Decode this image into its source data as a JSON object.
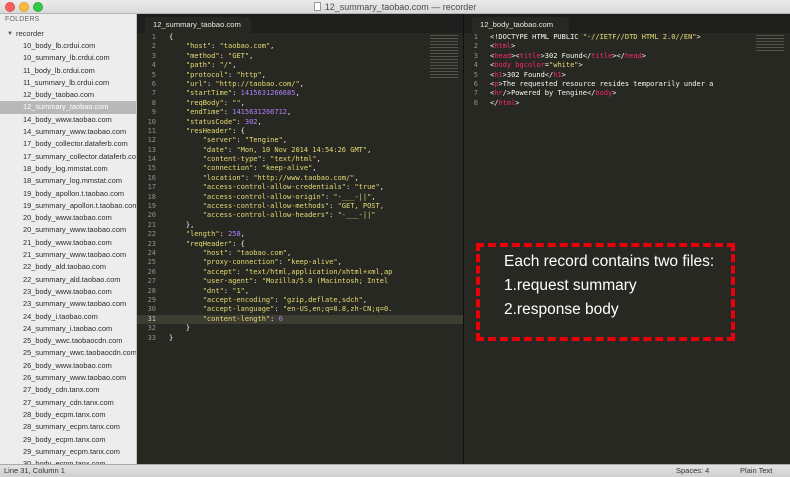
{
  "window": {
    "title": "12_summary_taobao.com — recorder"
  },
  "sidebar": {
    "header": "FOLDERS",
    "folder": "recorder",
    "files": [
      "10_body_lb.crdui.com",
      "10_summary_lb.crdui.com",
      "11_body_lb.crdui.com",
      "11_summary_lb.crdui.com",
      "12_body_taobao.com",
      "12_summary_taobao.com",
      "14_body_www.taobao.com",
      "14_summary_www.taobao.com",
      "17_body_collector.dataferb.com",
      "17_summary_collector.dataferb.com",
      "18_body_log.mmstat.com",
      "18_summary_log.mmstat.com",
      "19_body_apollon.t.taobao.com",
      "19_summary_apollon.t.taobao.com",
      "20_body_www.taobao.com",
      "20_summary_www.taobao.com",
      "21_body_www.taobao.com",
      "21_summary_www.taobao.com",
      "22_body_ald.taobao.com",
      "22_summary_ald.taobao.com",
      "23_body_www.taobao.com",
      "23_summary_www.taobao.com",
      "24_body_i.taobao.com",
      "24_summary_i.taobao.com",
      "25_body_wwc.taobaocdn.com",
      "25_summary_wwc.taobaocdn.com",
      "26_body_www.taobao.com",
      "26_summary_www.taobao.com",
      "27_body_cdn.tanx.com",
      "27_summary_cdn.tanx.com",
      "28_body_ecpm.tanx.com",
      "28_summary_ecpm.tanx.com",
      "29_body_ecpm.tanx.com",
      "29_summary_ecpm.tanx.com",
      "30_body_ecpm.tanx.com"
    ],
    "selected_index": 5
  },
  "left_pane": {
    "tab": "12_summary_taobao.com",
    "current_line": 31,
    "lines": [
      [
        {
          "t": "{"
        }
      ],
      [
        {
          "t": "    "
        },
        {
          "t": "\"host\"",
          "c": "str"
        },
        {
          "t": ": "
        },
        {
          "t": "\"taobao.com\"",
          "c": "str"
        },
        {
          "t": ","
        }
      ],
      [
        {
          "t": "    "
        },
        {
          "t": "\"method\"",
          "c": "str"
        },
        {
          "t": ": "
        },
        {
          "t": "\"GET\"",
          "c": "str"
        },
        {
          "t": ","
        }
      ],
      [
        {
          "t": "    "
        },
        {
          "t": "\"path\"",
          "c": "str"
        },
        {
          "t": ": "
        },
        {
          "t": "\"/\"",
          "c": "str"
        },
        {
          "t": ","
        }
      ],
      [
        {
          "t": "    "
        },
        {
          "t": "\"protocol\"",
          "c": "str"
        },
        {
          "t": ": "
        },
        {
          "t": "\"http\"",
          "c": "str"
        },
        {
          "t": ","
        }
      ],
      [
        {
          "t": "    "
        },
        {
          "t": "\"url\"",
          "c": "str"
        },
        {
          "t": ": "
        },
        {
          "t": "\"http://taobao.com/\"",
          "c": "str"
        },
        {
          "t": ","
        }
      ],
      [
        {
          "t": "    "
        },
        {
          "t": "\"startTime\"",
          "c": "str"
        },
        {
          "t": ": "
        },
        {
          "t": "1415631266685",
          "c": "ent"
        },
        {
          "t": ","
        }
      ],
      [
        {
          "t": "    "
        },
        {
          "t": "\"reqBody\"",
          "c": "str"
        },
        {
          "t": ": "
        },
        {
          "t": "\"\"",
          "c": "str"
        },
        {
          "t": ","
        }
      ],
      [
        {
          "t": "    "
        },
        {
          "t": "\"endTime\"",
          "c": "str"
        },
        {
          "t": ": "
        },
        {
          "t": "1415631266712",
          "c": "ent"
        },
        {
          "t": ","
        }
      ],
      [
        {
          "t": "    "
        },
        {
          "t": "\"statusCode\"",
          "c": "str"
        },
        {
          "t": ": "
        },
        {
          "t": "302",
          "c": "ent"
        },
        {
          "t": ","
        }
      ],
      [
        {
          "t": "    "
        },
        {
          "t": "\"resHeader\"",
          "c": "str"
        },
        {
          "t": ": {"
        }
      ],
      [
        {
          "t": "        "
        },
        {
          "t": "\"server\"",
          "c": "str"
        },
        {
          "t": ": "
        },
        {
          "t": "\"Tengine\"",
          "c": "str"
        },
        {
          "t": ","
        }
      ],
      [
        {
          "t": "        "
        },
        {
          "t": "\"date\"",
          "c": "str"
        },
        {
          "t": ": "
        },
        {
          "t": "\"Mon, 10 Nov 2014 14:54:26 GMT\"",
          "c": "str"
        },
        {
          "t": ","
        }
      ],
      [
        {
          "t": "        "
        },
        {
          "t": "\"content-type\"",
          "c": "str"
        },
        {
          "t": ": "
        },
        {
          "t": "\"text/html\"",
          "c": "str"
        },
        {
          "t": ","
        }
      ],
      [
        {
          "t": "        "
        },
        {
          "t": "\"connection\"",
          "c": "str"
        },
        {
          "t": ": "
        },
        {
          "t": "\"keep-alive\"",
          "c": "str"
        },
        {
          "t": ","
        }
      ],
      [
        {
          "t": "        "
        },
        {
          "t": "\"location\"",
          "c": "str"
        },
        {
          "t": ": "
        },
        {
          "t": "\"http://www.taobao.com/\"",
          "c": "str"
        },
        {
          "t": ","
        }
      ],
      [
        {
          "t": "        "
        },
        {
          "t": "\"access-control-allow-credentials\"",
          "c": "str"
        },
        {
          "t": ": "
        },
        {
          "t": "\"true\"",
          "c": "str"
        },
        {
          "t": ","
        }
      ],
      [
        {
          "t": "        "
        },
        {
          "t": "\"access-control-allow-origin\"",
          "c": "str"
        },
        {
          "t": ": "
        },
        {
          "t": "\"-___-||\"",
          "c": "str"
        },
        {
          "t": ","
        }
      ],
      [
        {
          "t": "        "
        },
        {
          "t": "\"access-control-allow-methods\"",
          "c": "str"
        },
        {
          "t": ": "
        },
        {
          "t": "\"GET, POST, ",
          "c": "str"
        }
      ],
      [
        {
          "t": "        "
        },
        {
          "t": "\"access-control-allow-headers\"",
          "c": "str"
        },
        {
          "t": ": "
        },
        {
          "t": "\"-___-||\"",
          "c": "str"
        }
      ],
      [
        {
          "t": "    },"
        }
      ],
      [
        {
          "t": "    "
        },
        {
          "t": "\"length\"",
          "c": "str"
        },
        {
          "t": ": "
        },
        {
          "t": "258",
          "c": "ent"
        },
        {
          "t": ","
        }
      ],
      [
        {
          "t": "    "
        },
        {
          "t": "\"reqHeader\"",
          "c": "str"
        },
        {
          "t": ": {"
        }
      ],
      [
        {
          "t": "        "
        },
        {
          "t": "\"host\"",
          "c": "str"
        },
        {
          "t": ": "
        },
        {
          "t": "\"taobao.com\"",
          "c": "str"
        },
        {
          "t": ","
        }
      ],
      [
        {
          "t": "        "
        },
        {
          "t": "\"proxy-connection\"",
          "c": "str"
        },
        {
          "t": ": "
        },
        {
          "t": "\"keep-alive\"",
          "c": "str"
        },
        {
          "t": ","
        }
      ],
      [
        {
          "t": "        "
        },
        {
          "t": "\"accept\"",
          "c": "str"
        },
        {
          "t": ": "
        },
        {
          "t": "\"text/html,application/xhtml+xml,ap",
          "c": "str"
        }
      ],
      [
        {
          "t": "        "
        },
        {
          "t": "\"user-agent\"",
          "c": "str"
        },
        {
          "t": ": "
        },
        {
          "t": "\"Mozilla/5.0 (Macintosh; Intel ",
          "c": "str"
        }
      ],
      [
        {
          "t": "        "
        },
        {
          "t": "\"dnt\"",
          "c": "str"
        },
        {
          "t": ": "
        },
        {
          "t": "\"1\"",
          "c": "str"
        },
        {
          "t": ","
        }
      ],
      [
        {
          "t": "        "
        },
        {
          "t": "\"accept-encoding\"",
          "c": "str"
        },
        {
          "t": ": "
        },
        {
          "t": "\"gzip,deflate,sdch\"",
          "c": "str"
        },
        {
          "t": ","
        }
      ],
      [
        {
          "t": "        "
        },
        {
          "t": "\"accept-language\"",
          "c": "str"
        },
        {
          "t": ": "
        },
        {
          "t": "\"en-US,en;q=0.8,zh-CN;q=0.",
          "c": "str"
        }
      ],
      [
        {
          "t": "        "
        },
        {
          "t": "\"content-length\"",
          "c": "str"
        },
        {
          "t": ": "
        },
        {
          "t": "0",
          "c": "ent"
        }
      ],
      [
        {
          "t": "    }"
        }
      ],
      [
        {
          "t": "}"
        }
      ]
    ]
  },
  "right_pane": {
    "tab": "12_body_taobao.com",
    "lines": [
      [
        {
          "t": "<!DOCTYPE HTML PUBLIC "
        },
        {
          "t": "\"-//IETF//DTD HTML 2.0//EN\"",
          "c": "str"
        },
        {
          "t": ">"
        }
      ],
      [
        {
          "t": "<"
        },
        {
          "t": "html",
          "c": "tag"
        },
        {
          "t": ">"
        }
      ],
      [
        {
          "t": "<"
        },
        {
          "t": "head",
          "c": "tag"
        },
        {
          "t": "><"
        },
        {
          "t": "title",
          "c": "tag"
        },
        {
          "t": ">302 Found</"
        },
        {
          "t": "title",
          "c": "tag"
        },
        {
          "t": "></"
        },
        {
          "t": "head",
          "c": "tag"
        },
        {
          "t": ">"
        }
      ],
      [
        {
          "t": "<"
        },
        {
          "t": "body",
          "c": "tag"
        },
        {
          "t": " bgcolor",
          "c": "tag"
        },
        {
          "t": "="
        },
        {
          "t": "\"white\"",
          "c": "str"
        },
        {
          "t": ">"
        }
      ],
      [
        {
          "t": "<"
        },
        {
          "t": "h1",
          "c": "tag"
        },
        {
          "t": ">302 Found</"
        },
        {
          "t": "h1",
          "c": "tag"
        },
        {
          "t": ">"
        }
      ],
      [
        {
          "t": "<"
        },
        {
          "t": "p",
          "c": "tag"
        },
        {
          "t": ">The requested resource resides temporarily under a"
        }
      ],
      [
        {
          "t": "<"
        },
        {
          "t": "hr",
          "c": "tag"
        },
        {
          "t": "/>Powered by Tengine</"
        },
        {
          "t": "body",
          "c": "tag"
        },
        {
          "t": ">"
        }
      ],
      [
        {
          "t": "</"
        },
        {
          "t": "html",
          "c": "tag"
        },
        {
          "t": ">"
        }
      ]
    ]
  },
  "annotation": {
    "lines": [
      "Each record contains two files:",
      "1.request summary",
      "2.response body"
    ],
    "color": "#e8000a"
  },
  "status": {
    "position": "Line 31, Column 1",
    "spaces": "Spaces: 4",
    "syntax": "Plain Text"
  },
  "colors": {
    "editor_bg": "#272822",
    "string": "#e6db74",
    "tag": "#f92672",
    "number": "#ae81ff"
  }
}
